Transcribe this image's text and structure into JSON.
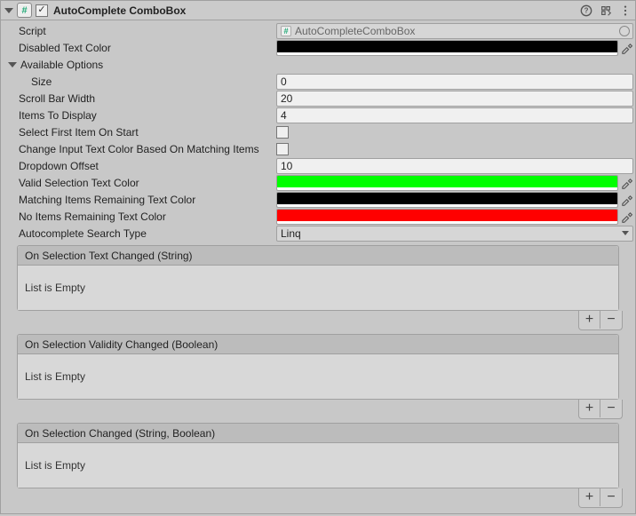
{
  "header": {
    "title": "AutoComplete ComboBox",
    "enabled": true
  },
  "props": {
    "script_label": "Script",
    "script_value": "AutoCompleteComboBox",
    "disabled_text_color_label": "Disabled Text Color",
    "disabled_text_color": "#000000",
    "available_options_label": "Available Options",
    "size_label": "Size",
    "size_value": "0",
    "scroll_bar_width_label": "Scroll Bar Width",
    "scroll_bar_width_value": "20",
    "items_to_display_label": "Items To Display",
    "items_to_display_value": "4",
    "select_first_item_label": "Select First Item On Start",
    "select_first_item_value": false,
    "change_color_label": "Change Input Text Color Based On Matching Items",
    "change_color_value": false,
    "dropdown_offset_label": "Dropdown Offset",
    "dropdown_offset_value": "10",
    "valid_selection_color_label": "Valid Selection Text Color",
    "valid_selection_color": "#00ff00",
    "matching_remaining_color_label": "Matching Items Remaining Text Color",
    "matching_remaining_color": "#000000",
    "no_items_color_label": "No Items Remaining Text Color",
    "no_items_color": "#ff0000",
    "search_type_label": "Autocomplete Search Type",
    "search_type_value": "Linq"
  },
  "events": {
    "empty_text": "List is Empty",
    "e1_title": "On Selection Text Changed (String)",
    "e2_title": "On Selection Validity Changed (Boolean)",
    "e3_title": "On Selection Changed (String, Boolean)"
  },
  "buttons": {
    "plus": "+",
    "minus": "−"
  }
}
